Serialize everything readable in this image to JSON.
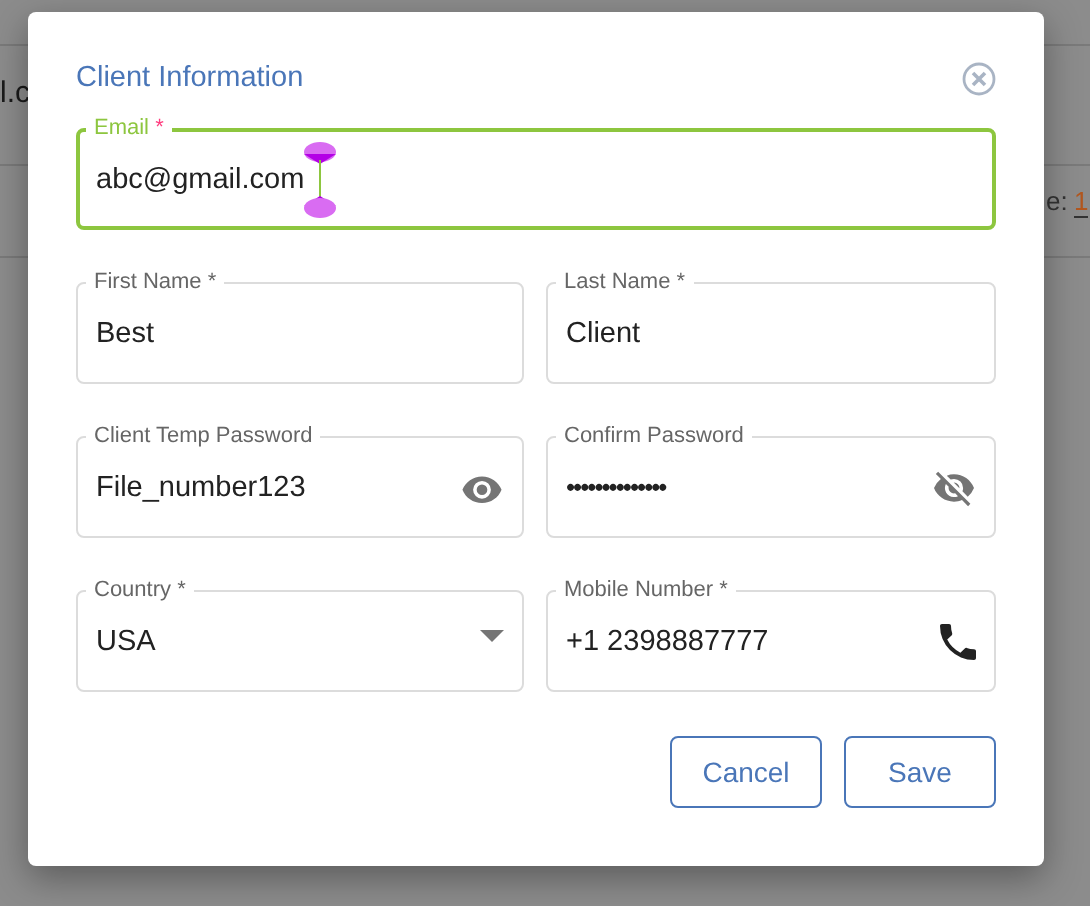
{
  "background": {
    "fragments": [
      "l.c",
      "e:",
      "1"
    ]
  },
  "dialog": {
    "title": "Client Information",
    "rows": [
      [
        {
          "kind": "text",
          "label": "Email",
          "required_mark": "*",
          "value": "abc@gmail.com",
          "focused": true
        }
      ],
      [
        {
          "kind": "text",
          "label": "First Name",
          "required_mark": "*",
          "value": "Best",
          "focused": false
        },
        {
          "kind": "text",
          "label": "Last Name",
          "required_mark": "*",
          "value": "Client",
          "focused": false
        }
      ],
      [
        {
          "kind": "password",
          "label": "Client Temp Password",
          "value": "File_number123",
          "revealed": true,
          "focused": false
        },
        {
          "kind": "password",
          "label": "Confirm Password",
          "value": "••••••••••••••",
          "revealed": false,
          "focused": false
        }
      ],
      [
        {
          "kind": "select",
          "label": "Country",
          "required_mark": "*",
          "value": "USA",
          "focused": false
        },
        {
          "kind": "phone",
          "label": "Mobile Number",
          "required_mark": "*",
          "value": "+1 2398887777",
          "focused": false
        }
      ]
    ],
    "buttons": [
      "Cancel",
      "Save"
    ]
  }
}
